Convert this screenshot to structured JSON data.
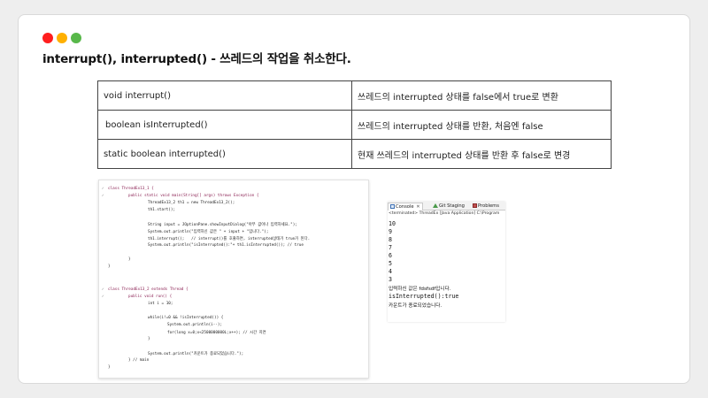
{
  "colors": {
    "dot_red": "#ff1e1e",
    "dot_yellow": "#ffb000",
    "dot_green": "#58b84a"
  },
  "window_dots": [
    "red-dot-icon",
    "yellow-dot-icon",
    "green-dot-icon"
  ],
  "title": "interrupt(), interrupted() - 쓰레드의 작업을 취소한다.",
  "methods": [
    {
      "signature": "void interrupt()",
      "description": "쓰레드의 interrupted 상태를 false에서 true로 변환"
    },
    {
      "signature": "boolean isInterrupted()",
      "description": "쓰레드의 interrupted 상태를 반환, 처음엔 false"
    },
    {
      "signature": "static boolean interrupted()",
      "description": "현재 쓰레드의 interrupted 상태를 반환 후 false로 변경"
    }
  ],
  "code_lines": [
    "class ThreadEx13_1 {",
    "public static void main(String[] args) throws Exception {",
    "ThreadEx13_2 th1 = new ThreadEx13_2();",
    "th1.start();",
    "String input = JOptionPane.showInputDialog(\"아무 값이나 입력하세요.\");",
    "System.out.println(\"입력하신 값은 \" + input + \"입니다.\");",
    "th1.interrupt();   // interrupt()를 호출하면, interrupted상태가 true가 된다.",
    "System.out.println(\"isInterrupted():\"+ th1.isInterrupted()); // true",
    "}",
    "}",
    "class ThreadEx13_2 extends Thread {",
    "public void run() {",
    "int i = 10;",
    "while(i!=0 && !isInterrupted()) {",
    "System.out.println(i--);",
    "for(long x=0;x<2500000000L;x++); // 시간 지연",
    "}",
    "System.out.println(\"카운트가 종료되었습니다.\");",
    "} // main",
    "}"
  ],
  "console": {
    "tabs": [
      "Console",
      "Git Staging",
      "Problems"
    ],
    "tab_icons": [
      "console-icon",
      "git-staging-icon",
      "problems-icon"
    ],
    "close_glyph": "✕",
    "status": "<terminated> ThreadEx [Java Application] C:\\Program",
    "output": [
      "10",
      "9",
      "8",
      "7",
      "6",
      "5",
      "4",
      "3",
      "입력하신 값은 fdsfsdf입니다.",
      "isInterrupted():true",
      "카운트가 종료되었습니다."
    ]
  }
}
